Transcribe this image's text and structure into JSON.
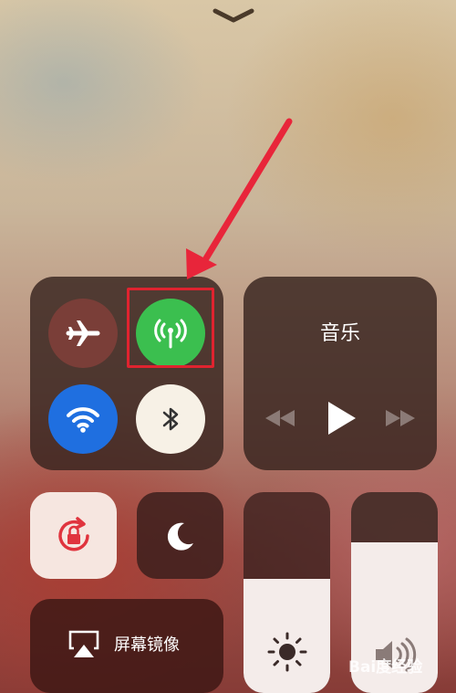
{
  "music": {
    "title": "音乐"
  },
  "screen_mirroring": {
    "label": "屏幕镜像"
  },
  "brightness": {
    "level_percent": 57
  },
  "volume": {
    "level_percent": 75
  },
  "toggles": {
    "airplane_mode": "off",
    "cellular_data": "on",
    "wifi": "on",
    "bluetooth": "on",
    "rotation_lock": "on",
    "do_not_disturb": "off"
  },
  "colors": {
    "cellular_on": "#3bbf4f",
    "wifi_on": "#1f6fe0",
    "highlight": "#e0232f"
  },
  "watermark": {
    "text": "Bai度经验"
  }
}
